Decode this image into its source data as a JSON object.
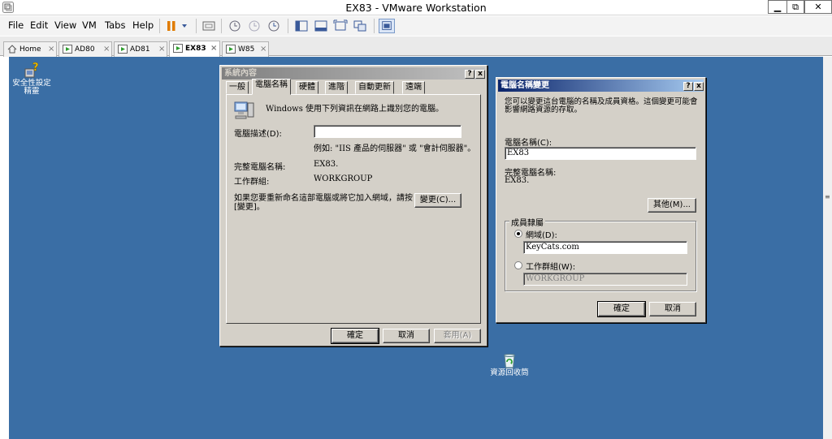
{
  "window": {
    "title": "EX83 - VMware Workstation",
    "minimize": "▁",
    "maximize": "⧉",
    "close": "✕"
  },
  "menu": [
    "File",
    "Edit",
    "View",
    "VM",
    "Tabs",
    "Help"
  ],
  "tabs": [
    {
      "label": "Home",
      "close": "×"
    },
    {
      "label": "AD80",
      "close": "×"
    },
    {
      "label": "AD81",
      "close": "×"
    },
    {
      "label": "EX83",
      "close": "×"
    },
    {
      "label": "W85",
      "close": "×"
    }
  ],
  "desktop": {
    "security_icon_label": "安全性設定\n精靈",
    "recycle_bin_label": "資源回收筒",
    "scroll_grip": "≡"
  },
  "sysprops": {
    "title": "系統內容",
    "help": "?",
    "close": "x",
    "tabs": [
      "一般",
      "電腦名稱",
      "硬體",
      "進階",
      "自動更新",
      "遠端"
    ],
    "intro": "Windows 使用下列資訊在網路上識別您的電腦。",
    "description_label": "電腦描述(D):",
    "description_value": "",
    "example": "例如: \"IIS 產品的伺服器\" 或 \"會計伺服器\"。",
    "full_name_label": "完整電腦名稱:",
    "full_name_value": "EX83.",
    "workgroup_label": "工作群組:",
    "workgroup_value": "WORKGROUP",
    "rename_text": "如果您要重新命名這部電腦或將它加入網域，請按 [變更]。",
    "change_button": "變更(C)...",
    "ok": "確定",
    "cancel": "取消",
    "apply": "套用(A)"
  },
  "rename": {
    "title": "電腦名稱變更",
    "help": "?",
    "close": "x",
    "intro": "您可以變更這台電腦的名稱及成員資格。這個變更可能會影響網路資源的存取。",
    "computer_name_label": "電腦名稱(C):",
    "computer_name_value": "EX83",
    "full_name_label": "完整電腦名稱:",
    "full_name_value": "EX83.",
    "more_button": "其他(M)...",
    "member_of_label": "成員隸屬",
    "domain_label": "網域(D):",
    "domain_value": "KeyCats.com",
    "workgroup_label": "工作群組(W):",
    "workgroup_value": "WORKGROUP",
    "ok": "確定",
    "cancel": "取消"
  }
}
